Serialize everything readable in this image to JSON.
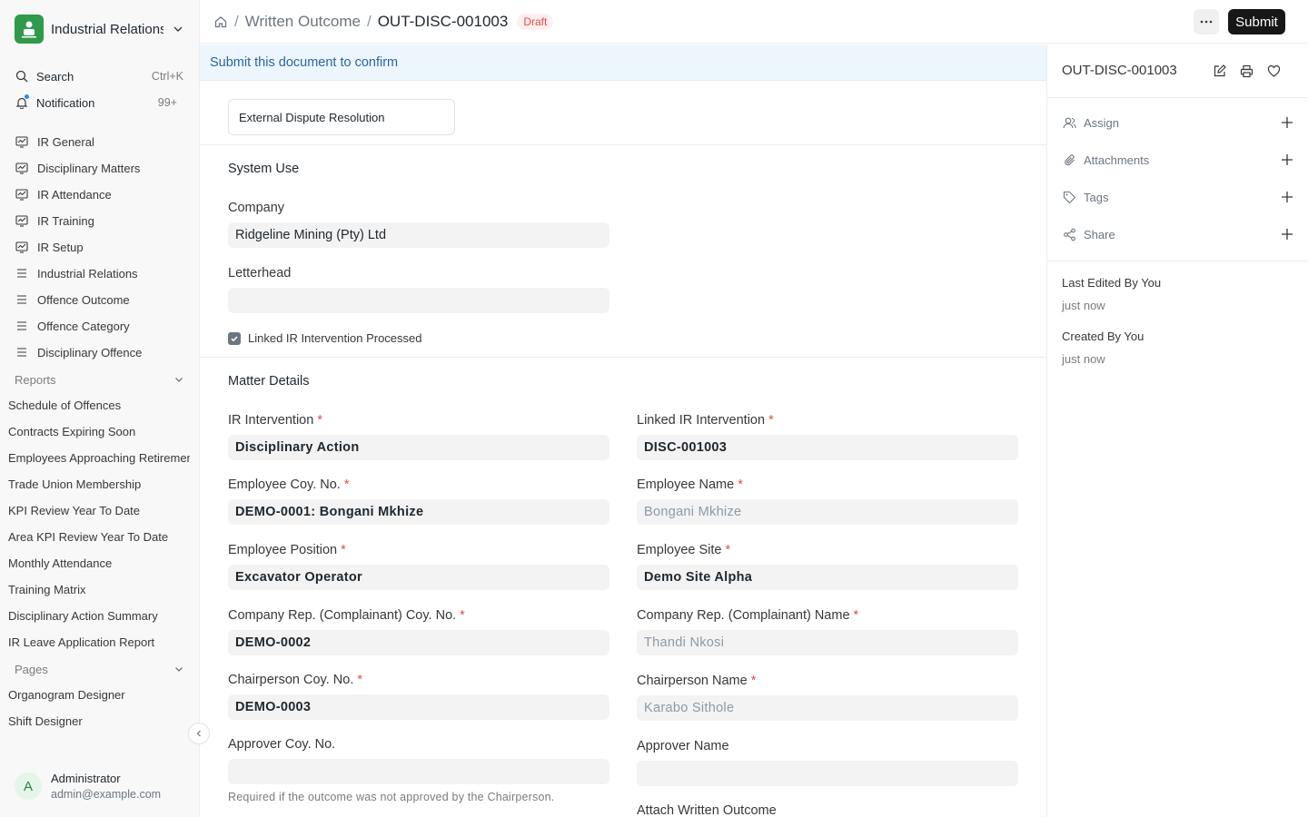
{
  "app": {
    "title": "Industrial Relations"
  },
  "sidebar": {
    "search": {
      "label": "Search",
      "shortcut": "Ctrl+K"
    },
    "notification": {
      "label": "Notification",
      "count": "99+"
    },
    "workspaces": [
      {
        "label": "IR General",
        "icon": "workspace-icon"
      },
      {
        "label": "Disciplinary Matters",
        "icon": "workspace-icon"
      },
      {
        "label": "IR Attendance",
        "icon": "workspace-icon"
      },
      {
        "label": "IR Training",
        "icon": "workspace-icon"
      },
      {
        "label": "IR Setup",
        "icon": "workspace-icon"
      },
      {
        "label": "Industrial Relations",
        "icon": "list-icon"
      },
      {
        "label": "Offence Outcome",
        "icon": "list-icon"
      },
      {
        "label": "Offence Category",
        "icon": "list-icon"
      },
      {
        "label": "Disciplinary Offence",
        "icon": "list-icon"
      }
    ],
    "reports_label": "Reports",
    "reports": [
      "Schedule of Offences",
      "Contracts Expiring Soon",
      "Employees Approaching Retirement",
      "Trade Union Membership",
      "KPI Review Year To Date",
      "Area KPI Review Year To Date",
      "Monthly Attendance",
      "Training Matrix",
      "Disciplinary Action Summary",
      "IR Leave Application Report"
    ],
    "pages_label": "Pages",
    "pages": [
      "Organogram Designer",
      "Shift Designer"
    ],
    "user": {
      "initial": "A",
      "name": "Administrator",
      "email": "admin@example.com"
    }
  },
  "topbar": {
    "breadcrumb_parent": "Written Outcome",
    "breadcrumb_current": "OUT-DISC-001003",
    "status": "Draft",
    "submit_label": "Submit"
  },
  "form": {
    "banner": "Submit this document to confirm",
    "tab_value": "External Dispute Resolution",
    "system_section": "System Use",
    "company_label": "Company",
    "company_value": "Ridgeline Mining (Pty) Ltd",
    "letterhead_label": "Letterhead",
    "letterhead_value": "",
    "checkbox_label": "Linked IR Intervention Processed",
    "checkbox_checked": true,
    "matter_section": "Matter Details",
    "fields": {
      "ir_intervention": {
        "label": "IR Intervention",
        "value": "Disciplinary Action"
      },
      "linked_ir": {
        "label": "Linked IR Intervention",
        "value": "DISC-001003"
      },
      "emp_coy": {
        "label": "Employee Coy. No.",
        "value": "DEMO-0001: Bongani Mkhize"
      },
      "emp_name": {
        "label": "Employee Name",
        "value": "Bongani Mkhize"
      },
      "emp_position": {
        "label": "Employee Position",
        "value": "Excavator Operator"
      },
      "emp_site": {
        "label": "Employee Site",
        "value": "Demo Site Alpha"
      },
      "rep_coy": {
        "label": "Company Rep. (Complainant) Coy. No.",
        "value": "DEMO-0002"
      },
      "rep_name": {
        "label": "Company Rep. (Complainant) Name",
        "value": "Thandi Nkosi"
      },
      "chair_coy": {
        "label": "Chairperson Coy. No.",
        "value": "DEMO-0003"
      },
      "chair_name": {
        "label": "Chairperson Name",
        "value": "Karabo Sithole"
      },
      "approver_coy": {
        "label": "Approver Coy. No.",
        "value": ""
      },
      "approver_name": {
        "label": "Approver Name",
        "value": ""
      },
      "approver_help": "Required if the outcome was not approved by the Chairperson.",
      "attach_label": "Attach Written Outcome"
    },
    "required_mark": "*"
  },
  "rightpanel": {
    "doc_name": "OUT-DISC-001003",
    "rows": [
      {
        "label": "Assign",
        "icon": "user-icon"
      },
      {
        "label": "Attachments",
        "icon": "paperclip-icon"
      },
      {
        "label": "Tags",
        "icon": "tag-icon"
      },
      {
        "label": "Share",
        "icon": "share-icon"
      }
    ],
    "last_edited_label": "Last Edited By You",
    "last_edited_time": "just now",
    "created_label": "Created By You",
    "created_time": "just now"
  },
  "colors": {
    "accent": "#2490ef",
    "logo": "#2e9a4a",
    "draft": "#e24c4c",
    "submit": "#171717"
  }
}
